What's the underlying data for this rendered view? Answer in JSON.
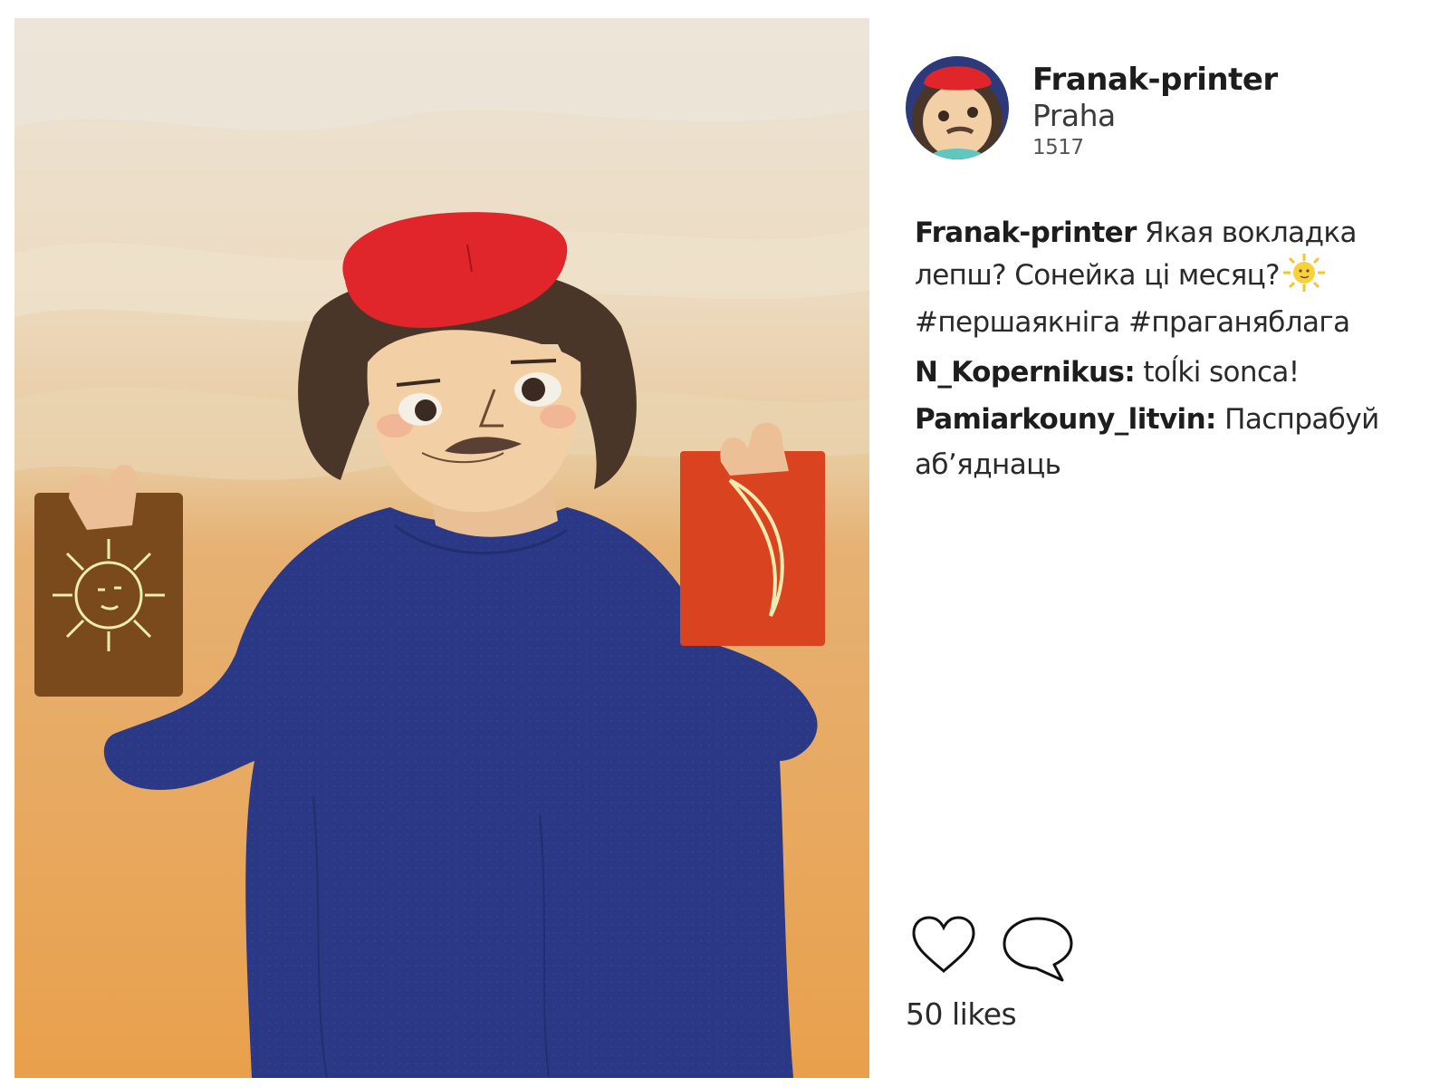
{
  "post": {
    "author": {
      "username": "Franak-printer",
      "location": "Praha",
      "year": "1517",
      "avatar_icon": "avatar-icon"
    },
    "caption": {
      "author": "Franak-printer",
      "text": "Якая вокладка лепш? Сонейка ці месяц?",
      "emoji_icon": "sun-emoji-icon",
      "hashtags": "#першаякніга #праганяблага"
    },
    "comments": [
      {
        "author": "N_Kopernikus:",
        "text": "toĺki sonca!"
      },
      {
        "author": "Pamiarkouny_litvin:",
        "text": "Паспрабуй аб’яднаць"
      }
    ],
    "actions": {
      "like_icon": "heart-icon",
      "comment_icon": "comment-bubble-icon"
    },
    "likes": "50 likes"
  },
  "colors": {
    "beret": "#e0262b",
    "tunic": "#2b3885",
    "sky_top": "#e9dfcd",
    "ground": "#e9a24f",
    "book_left": "#7a4a1c",
    "book_right": "#d9431f",
    "gold": "#e9e3a0"
  }
}
